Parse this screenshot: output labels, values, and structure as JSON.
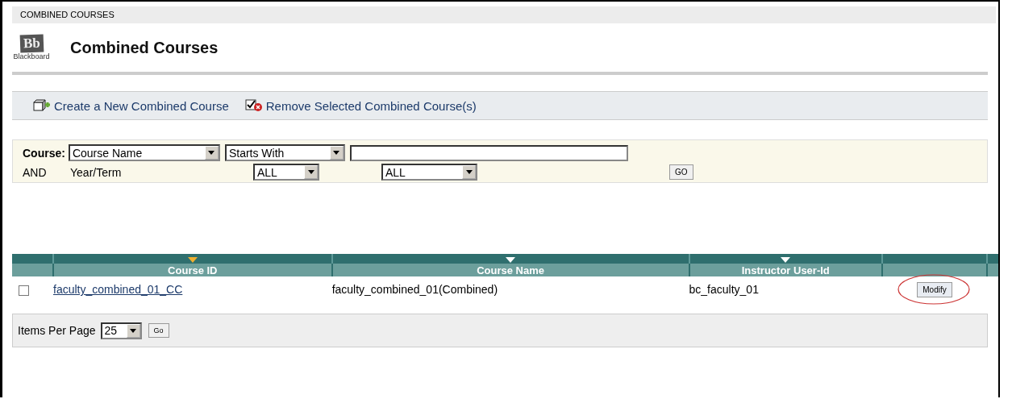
{
  "breadcrumb": "COMBINED COURSES",
  "logo": {
    "mark": "Bb",
    "caption": "Blackboard"
  },
  "page_title": "Combined Courses",
  "actions": [
    {
      "label": "Create a New Combined Course",
      "kind": "create"
    },
    {
      "label": "Remove Selected Combined Course(s)",
      "kind": "remove"
    }
  ],
  "search": {
    "course_label": "Course:",
    "field": "Course Name",
    "operator": "Starts With",
    "and_label": "AND",
    "term_label": "Year/Term",
    "year": "ALL",
    "term": "ALL",
    "go": "GO"
  },
  "table": {
    "columns": [
      {
        "label": "Course ID",
        "sorted": true
      },
      {
        "label": "Course Name",
        "sorted": false
      },
      {
        "label": "Instructor User-Id",
        "sorted": false
      }
    ],
    "rows": [
      {
        "checked": false,
        "course_id": "faculty_combined_01_CC",
        "course_name": "faculty_combined_01(Combined)",
        "instructor": "bc_faculty_01",
        "action": "Modify",
        "circled": true
      }
    ]
  },
  "footer": {
    "label": "Items Per Page",
    "per_page": "25",
    "go": "Go"
  }
}
